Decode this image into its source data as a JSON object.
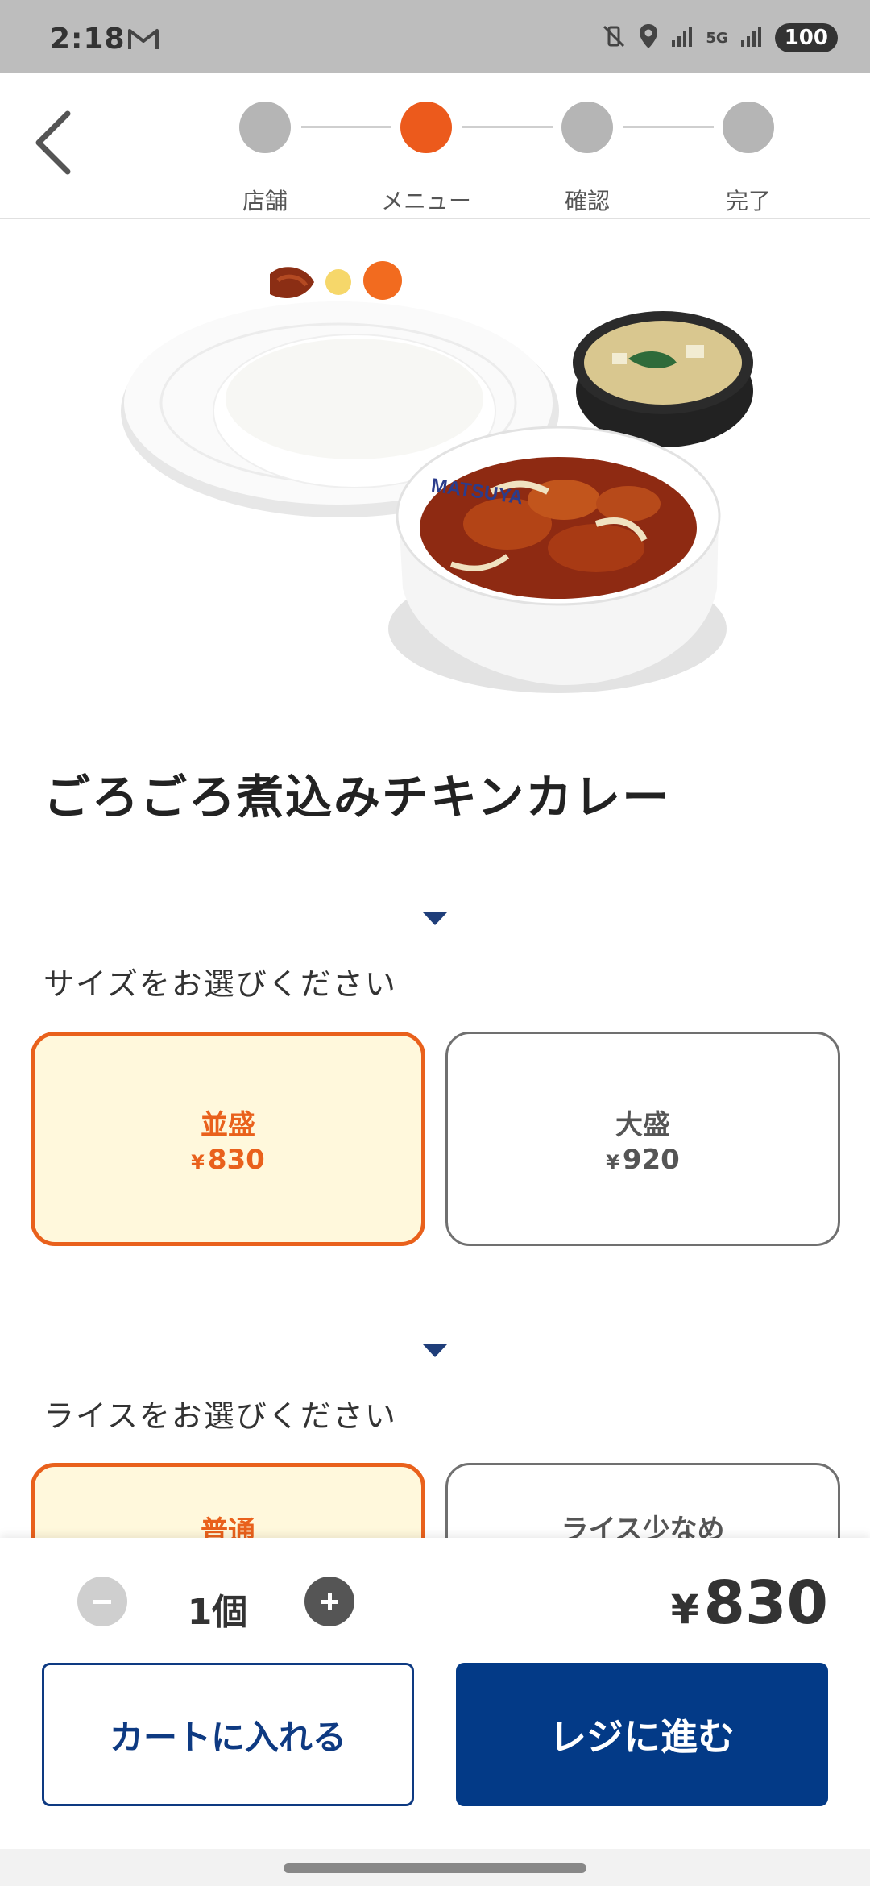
{
  "status_bar": {
    "time": "2:18",
    "battery": "100",
    "network": "5G"
  },
  "stepper": {
    "steps": [
      {
        "label": "店舗",
        "active": false
      },
      {
        "label": "メニュー",
        "active": true
      },
      {
        "label": "確認",
        "active": false
      },
      {
        "label": "完了",
        "active": false
      }
    ],
    "active_color": "#ec5a1c",
    "inactive_color": "#b5b5b5"
  },
  "product": {
    "image_icon": "food-photo",
    "bowl_brand": "MATSUYA",
    "name": "ごろごろ煮込みチキンカレー"
  },
  "size_section": {
    "title": "サイズをお選びください",
    "options": [
      {
        "name": "並盛",
        "yen": "¥",
        "price": "830",
        "selected": true
      },
      {
        "name": "大盛",
        "yen": "¥",
        "price": "920",
        "selected": false
      }
    ]
  },
  "rice_section": {
    "title": "ライスをお選びください",
    "options": [
      {
        "name": "普通",
        "selected": true
      },
      {
        "name": "ライス少なめ",
        "selected": false
      }
    ]
  },
  "cart": {
    "quantity_text": "1個",
    "total_yen": "¥",
    "total": "830",
    "add_to_cart_label": "カートに入れる",
    "checkout_label": "レジに進む"
  },
  "colors": {
    "accent_orange": "#e9611c",
    "selected_bg": "#fff8dc",
    "navy": "#033a87"
  }
}
